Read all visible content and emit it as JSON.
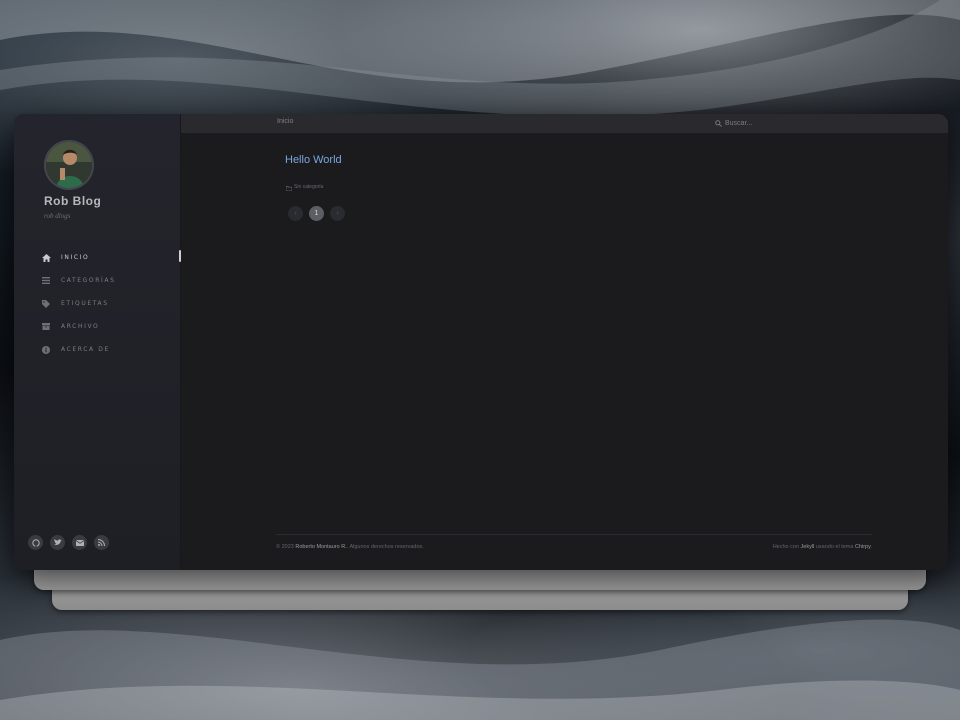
{
  "site": {
    "title": "Rob Blog",
    "subtitle": "rob dlogs"
  },
  "nav": [
    {
      "label": "INICIO",
      "icon": "home-icon",
      "active": true
    },
    {
      "label": "CATEGORÍAS",
      "icon": "stream-icon",
      "active": false
    },
    {
      "label": "ETIQUETAS",
      "icon": "tag-icon",
      "active": false
    },
    {
      "label": "ARCHIVO",
      "icon": "archive-icon",
      "active": false
    },
    {
      "label": "ACERCA DE",
      "icon": "info-icon",
      "active": false
    }
  ],
  "socials": [
    "github-icon",
    "twitter-icon",
    "email-icon",
    "rss-icon"
  ],
  "topbar": {
    "breadcrumb": "Inicio",
    "search_placeholder": "Buscar..."
  },
  "post": {
    "title": "Hello World",
    "meta": "Sin categoría"
  },
  "pagination": {
    "prev": "‹",
    "current": "1",
    "next": "›"
  },
  "footer": {
    "year": "© 2023",
    "author": "Roberto Montauro R.",
    "rights": "Algunos derechos reservados.",
    "powered_prefix": "Hecho con",
    "engine": "Jekyll",
    "theme_mid": "usando el tema",
    "theme": "Chirpy"
  },
  "colors": {
    "accent": "#79a7de",
    "sidebar": "#24252c",
    "main": "#1b1b1e"
  }
}
